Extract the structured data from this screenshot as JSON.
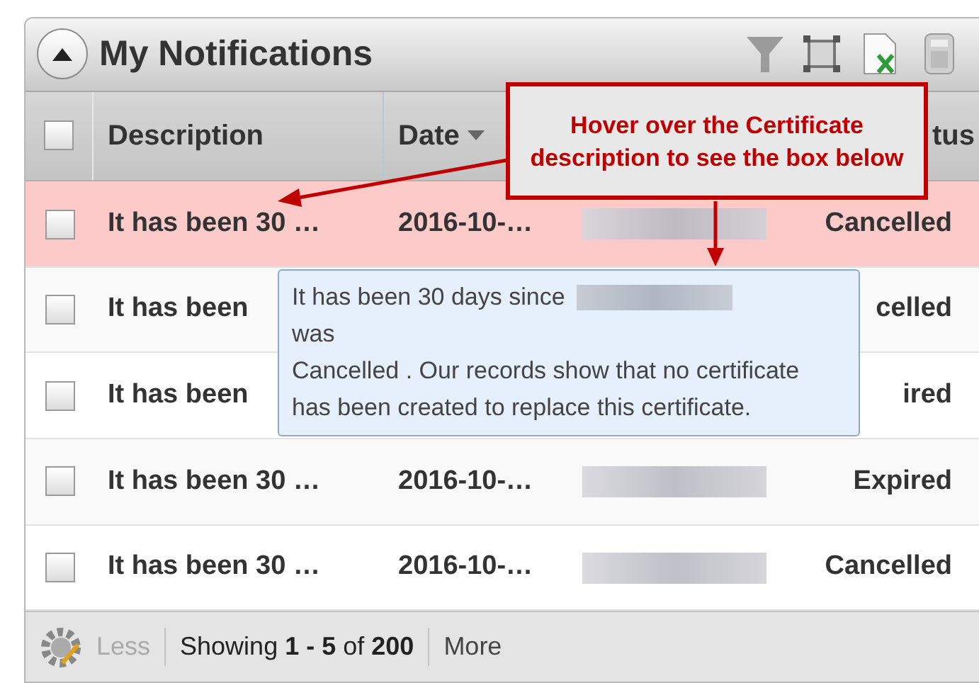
{
  "panel": {
    "title": "My Notifications"
  },
  "columns": [
    {
      "kind": "check",
      "checked": false
    },
    {
      "kind": "text",
      "label": "Description",
      "sorted": false
    },
    {
      "kind": "text",
      "label": "Date",
      "sorted": true
    },
    {
      "kind": "hidden"
    },
    {
      "kind": "text",
      "label": "tus",
      "sorted": false
    }
  ],
  "rows": [
    {
      "highlighted": true,
      "checked": false,
      "description": "It has been 30 …",
      "date": "2016-10-…",
      "redacted": true,
      "status": "Cancelled"
    },
    {
      "highlighted": false,
      "checked": false,
      "description": "It has been",
      "date": "",
      "redacted": false,
      "status": "celled"
    },
    {
      "highlighted": false,
      "checked": false,
      "description": "It has been",
      "date": "",
      "redacted": false,
      "status": "ired"
    },
    {
      "highlighted": false,
      "checked": false,
      "description": "It has been 30 …",
      "date": "2016-10-…",
      "redacted": true,
      "status": "Expired"
    },
    {
      "highlighted": false,
      "checked": false,
      "description": "It has been 30 …",
      "date": "2016-10-…",
      "redacted": true,
      "status": "Cancelled"
    }
  ],
  "footer": {
    "less": "Less",
    "showing": "Showing **1 - 5** of **200**",
    "more": "More"
  },
  "callout": {
    "text": "Hover over the Certificate description to see the box below"
  },
  "tooltip": {
    "line_1": "It has been 30 days since",
    "line_2": "was",
    "body": "Cancelled . Our records show that no certificate has been created to replace this certificate."
  }
}
